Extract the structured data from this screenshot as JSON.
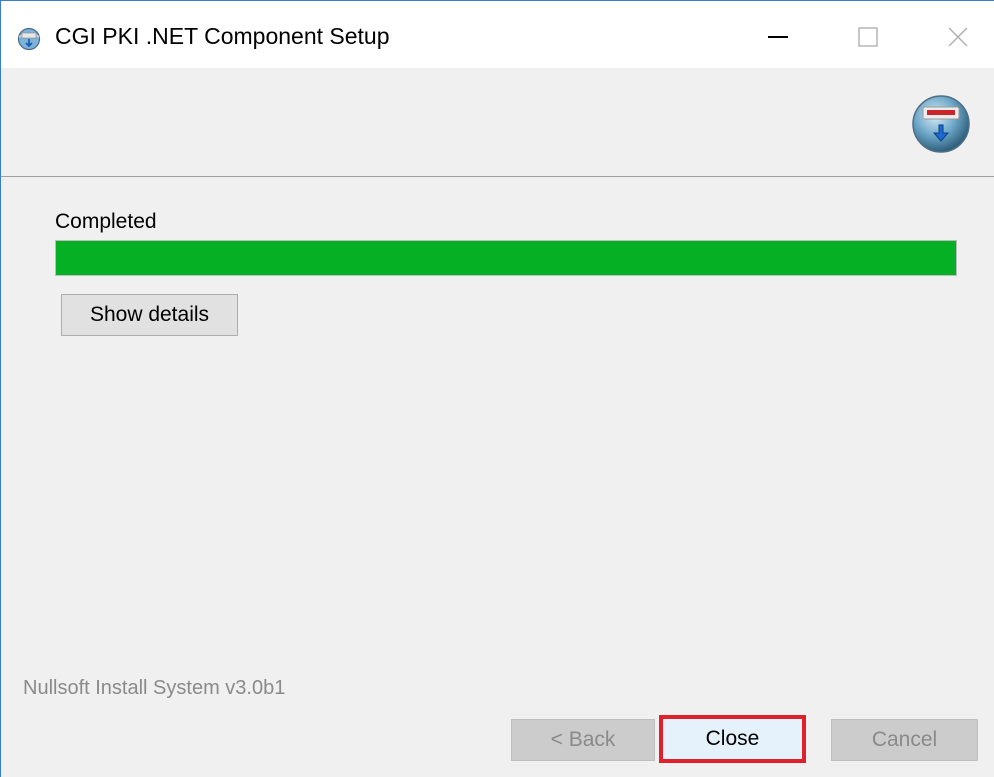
{
  "window": {
    "title": "CGI PKI .NET Component Setup",
    "app_icon": "installer-globe-icon",
    "controls": {
      "minimize_icon": "minimize-icon",
      "maximize_icon": "maximize-icon",
      "close_icon": "close-icon"
    }
  },
  "header": {
    "logo": "nsis-logo-icon"
  },
  "progress": {
    "status": "Completed",
    "percent": 100,
    "color": "#06b025"
  },
  "buttons": {
    "show_details": "Show details",
    "back": "< Back",
    "close": "Close",
    "cancel": "Cancel"
  },
  "branding": {
    "text": "Nullsoft Install System v3.0b1"
  },
  "colors": {
    "highlight_border": "#e0202a",
    "accent_border": "#3a7bd5"
  }
}
